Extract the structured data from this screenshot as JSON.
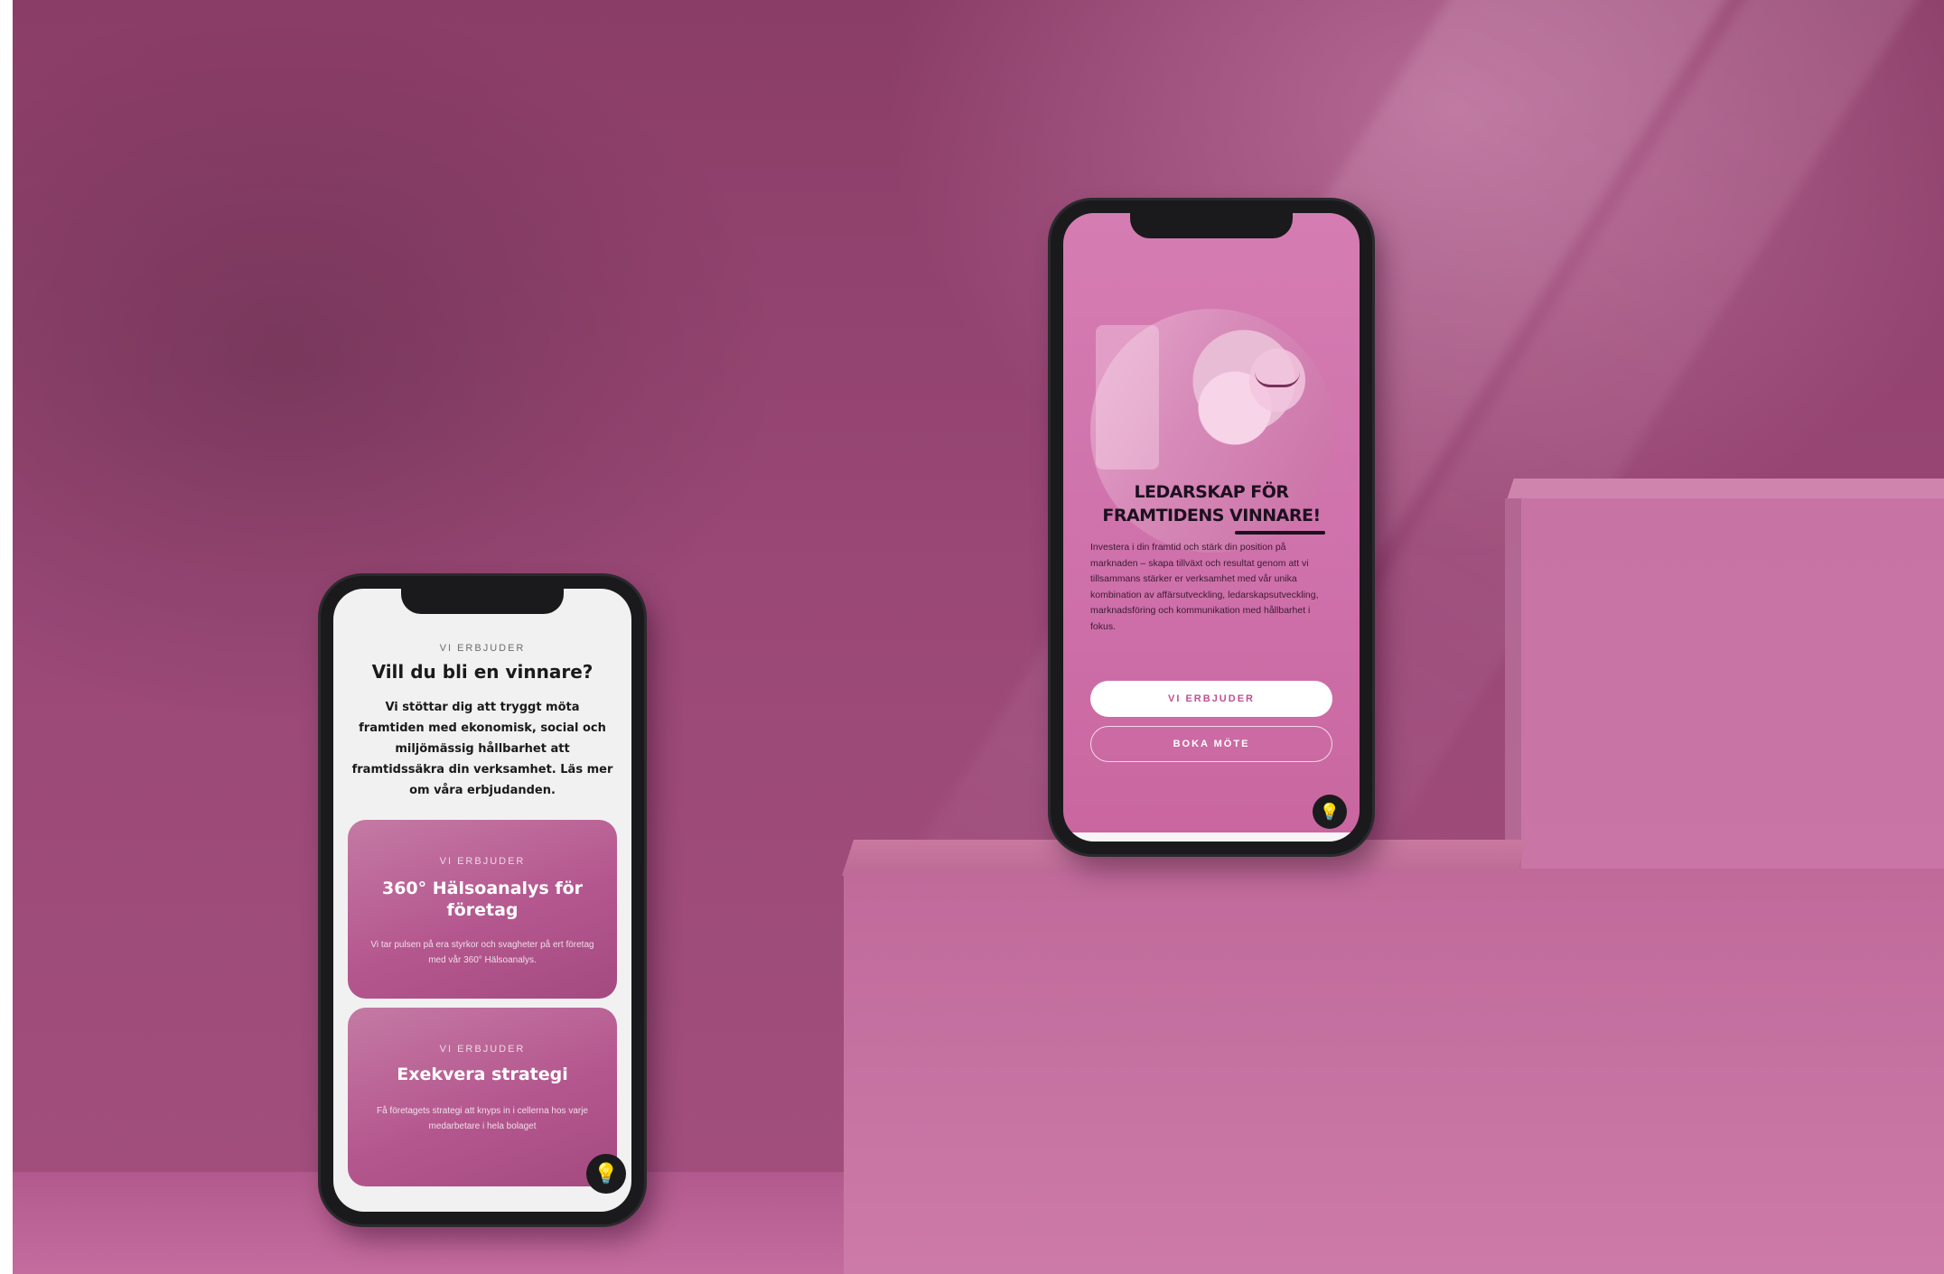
{
  "phone_left": {
    "eyebrow": "VI ERBJUDER",
    "title": "Vill du bli en vinnare?",
    "body": "Vi stöttar dig att tryggt möta framtiden med ekonomisk, social och miljömässig hållbarhet att framtidssäkra din verksamhet. Läs mer om våra erbjudanden.",
    "cards": [
      {
        "eyebrow": "VI ERBJUDER",
        "title": "360° Hälsoanalys för företag",
        "text": "Vi tar pulsen på era styrkor och svagheter på ert företag med vår 360° Hälsoanalys."
      },
      {
        "eyebrow": "VI ERBJUDER",
        "title": "Exekvera strategi",
        "text": "Få företagets strategi att knyps in i cellerna hos varje medarbetare i hela bolaget"
      }
    ],
    "chat_icon": "chat-bubble-icon"
  },
  "phone_right": {
    "title_line1": "LEDARSKAP FÖR",
    "title_line2": "FRAMTIDENS VINNARE!",
    "body": "Investera i din framtid och stärk din position på marknaden – skapa tillväxt och resultat genom att vi tillsammans stärker er verksamhet med vår unika kombination av affärsutveckling, ledarskapsutveckling, marknadsföring och kommunikation med hållbarhet i fokus.",
    "primary_button": "VI ERBJUDER",
    "secondary_button": "BOKA MÖTE",
    "chat_icon": "chat-bubble-icon"
  },
  "colors": {
    "accent": "#c0508f",
    "background": "#9a4876",
    "card": "#b5578f"
  }
}
